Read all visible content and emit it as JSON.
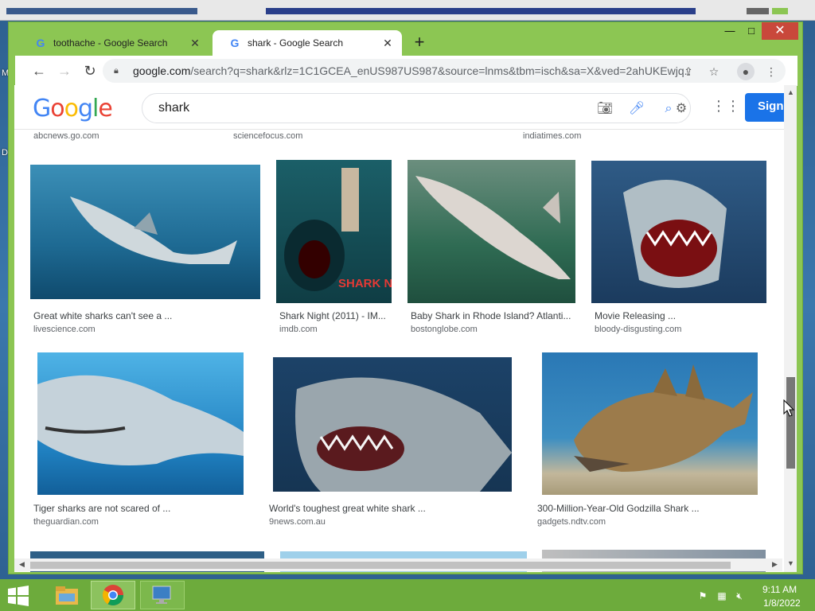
{
  "browser": {
    "tabs": [
      {
        "title": "toothache - Google Search",
        "active": false
      },
      {
        "title": "shark - Google Search",
        "active": true
      }
    ],
    "new_tab_label": "+",
    "window_controls": {
      "minimize": "—",
      "maximize": "□",
      "close": "✕"
    },
    "url": {
      "domain": "google.com",
      "rest": "/search?q=shark&rlz=1C1GCEA_enUS987US987&source=lnms&tbm=isch&sa=X&ved=2ahUKEwjq..."
    }
  },
  "google": {
    "search_value": "shark",
    "signin_label": "Sign"
  },
  "top_sources": [
    "abcnews.go.com",
    "sciencefocus.com",
    "indiatimes.com"
  ],
  "results_row1": [
    {
      "caption": "Great white sharks can't see a ...",
      "source": "livescience.com"
    },
    {
      "caption": "Shark Night (2011) - IM...",
      "source": "imdb.com",
      "poster_text": "SHARK NIGHT"
    },
    {
      "caption": "Baby Shark in Rhode Island? Atlanti...",
      "source": "bostonglobe.com"
    },
    {
      "caption": "Movie Releasing ...",
      "source": "bloody-disgusting.com"
    }
  ],
  "results_row2": [
    {
      "caption": "Tiger sharks are not scared of ...",
      "source": "theguardian.com"
    },
    {
      "caption": "World's toughest great white shark ...",
      "source": "9news.com.au"
    },
    {
      "caption": "300-Million-Year-Old Godzilla Shark ...",
      "source": "gadgets.ndtv.com"
    }
  ],
  "taskbar": {
    "time": "9:11 AM",
    "date": "1/8/2022"
  },
  "colors": {
    "window_frame": "#8cc653",
    "taskbar": "#6dab3c",
    "google_blue": "#1a73e8"
  }
}
